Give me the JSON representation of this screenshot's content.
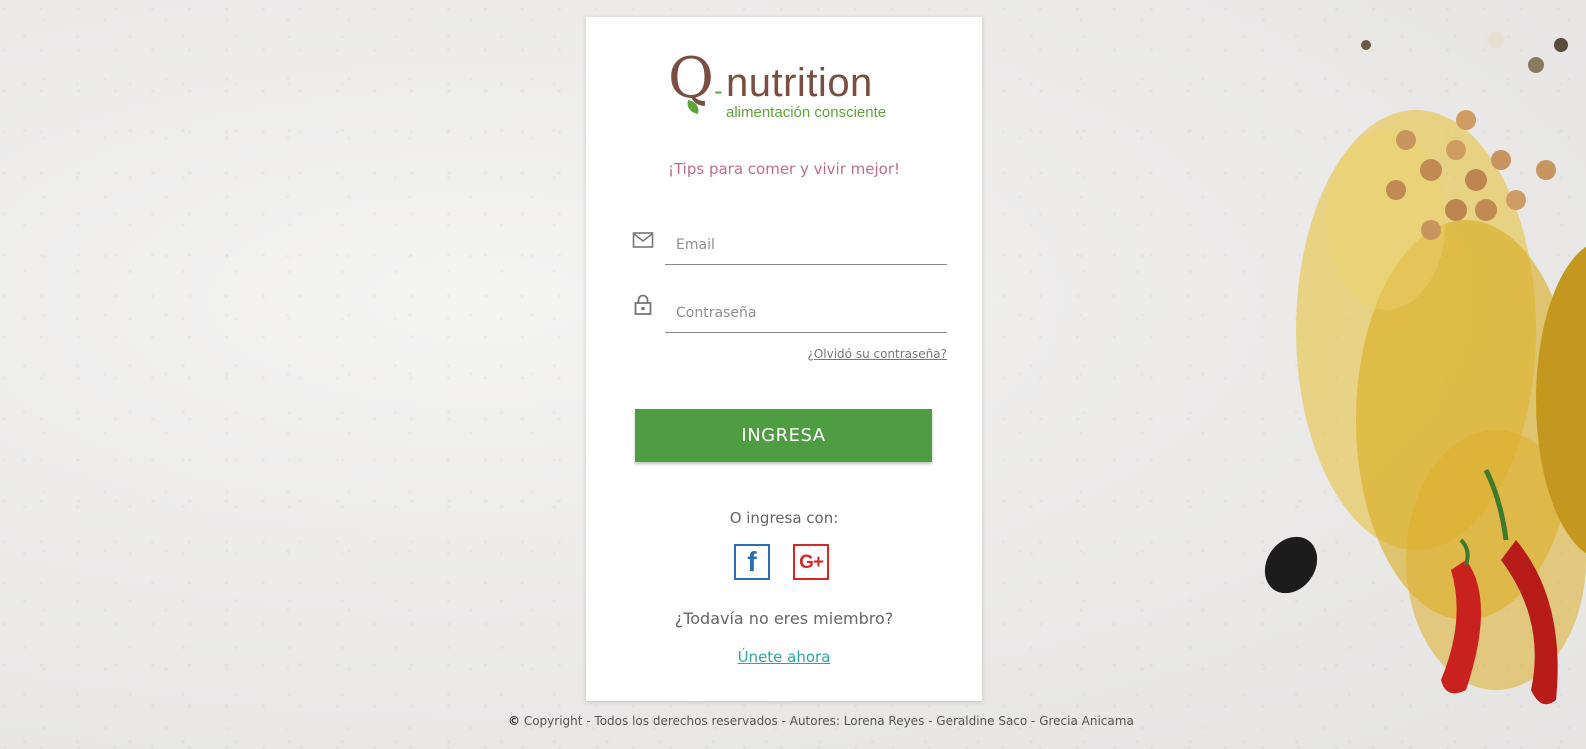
{
  "logo": {
    "letter": "Q",
    "dash": "-",
    "name": "nutrition",
    "tagline": "alimentación consciente"
  },
  "tagline": "¡Tips para comer y vivir mejor!",
  "form": {
    "email_placeholder": "Email",
    "password_placeholder": "Contraseña",
    "forgot_label": "¿Olvidó su contraseña?",
    "submit_label": "INGRESA"
  },
  "social": {
    "or_label": "O ingresa con:",
    "facebook_glyph": "f",
    "google_glyph": "G+"
  },
  "signup": {
    "question": "¿Todavía no eres miembro?",
    "link_label": "Únete ahora"
  },
  "footer": {
    "symbol": "©",
    "text": "Copyright - Todos los derechos reservados - Autores: Lorena Reyes - Geraldine Saco - Grecia Anicama"
  },
  "colors": {
    "primary_green": "#4f9d43",
    "logo_brown": "#7b4e43",
    "logo_green": "#5ea43a",
    "tagline_pink": "#c26c8c",
    "link_teal": "#2aa8a4",
    "facebook_blue": "#2a6fb3",
    "google_red": "#d62828"
  },
  "icons": {
    "email": "mail-icon",
    "password": "lock-icon",
    "facebook": "facebook-icon",
    "google": "google-plus-icon"
  }
}
